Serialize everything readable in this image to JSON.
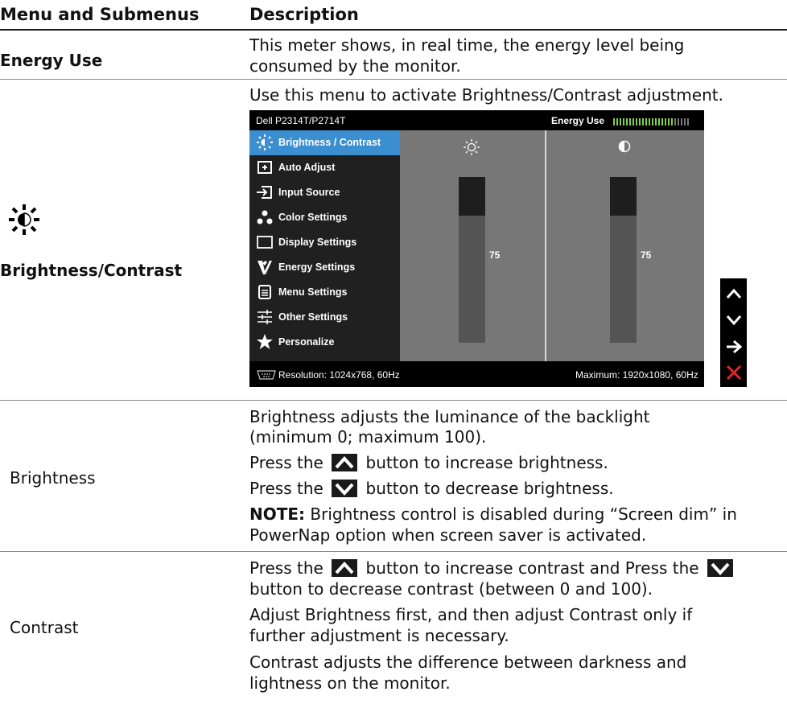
{
  "headers": {
    "col1": "Menu and Submenus",
    "col2": "Description"
  },
  "energy_use": {
    "label": "Energy Use",
    "desc_line1": "This meter shows, in real time, the energy level being",
    "desc_line2": "consumed by the monitor."
  },
  "brightness_contrast": {
    "label": "Brightness/Contrast",
    "intro": "Use this menu to activate Brightness/Contrast adjustment."
  },
  "osd": {
    "model": "Dell P2314T/P2714T",
    "energy_label": "Energy Use",
    "menu": [
      {
        "label": "Brightness / Contrast",
        "icon": "brightness-icon",
        "selected": true
      },
      {
        "label": "Auto Adjust",
        "icon": "auto-adjust-icon"
      },
      {
        "label": "Input Source",
        "icon": "input-source-icon"
      },
      {
        "label": "Color Settings",
        "icon": "color-settings-icon"
      },
      {
        "label": "Display Settings",
        "icon": "display-settings-icon"
      },
      {
        "label": "Energy Settings",
        "icon": "energy-settings-icon"
      },
      {
        "label": "Menu Settings",
        "icon": "menu-settings-icon"
      },
      {
        "label": "Other Settings",
        "icon": "other-settings-icon"
      },
      {
        "label": "Personalize",
        "icon": "star-icon"
      }
    ],
    "brightness_value": "75",
    "contrast_value": "75",
    "resolution": "Resolution: 1024x768, 60Hz",
    "maximum": "Maximum: 1920x1080, 60Hz",
    "accent_color": "#3b8fd0",
    "close_color": "#e0262c"
  },
  "brightness": {
    "label": "Brightness",
    "p1_line1": "Brightness adjusts the luminance of the backlight",
    "p1_line2": "(minimum 0; maximum 100).",
    "press": "Press the",
    "inc_rest": "button to increase brightness.",
    "dec_rest": "button to decrease brightness.",
    "note_label": "NOTE:",
    "note_line1": " Brightness control is disabled during “Screen dim” in",
    "note_line2": "PowerNap option when screen saver is activated."
  },
  "contrast": {
    "label": "Contrast",
    "press": "Press the",
    "mid": "button to increase contrast and Press the",
    "line2": "button to decrease contrast (between 0 and 100).",
    "p2_line1": "Adjust Brightness first, and then adjust Contrast only if",
    "p2_line2": "further adjustment is necessary.",
    "p3_line1": "Contrast adjusts the difference between darkness and",
    "p3_line2": "lightness on the monitor."
  }
}
